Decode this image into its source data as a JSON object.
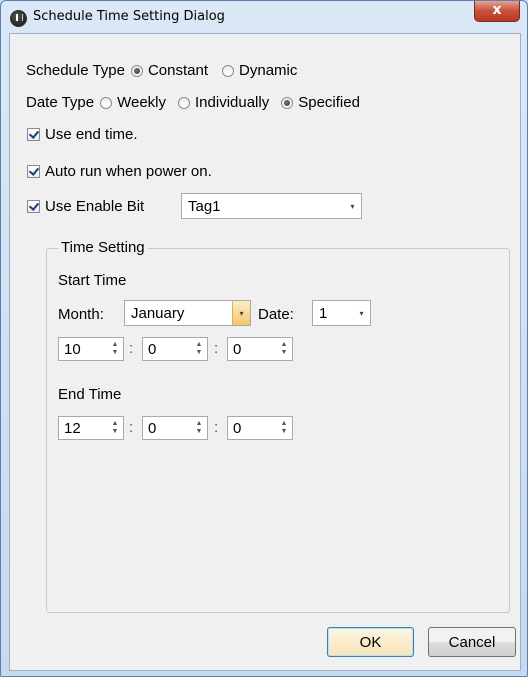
{
  "window": {
    "title": "Schedule Time Setting Dialog",
    "close_label": "x"
  },
  "schedule_type": {
    "label": "Schedule Type",
    "options": [
      {
        "label": "Constant",
        "selected": true
      },
      {
        "label": "Dynamic",
        "selected": false
      }
    ]
  },
  "date_type": {
    "label": "Date Type",
    "options": [
      {
        "label": "Weekly",
        "selected": false
      },
      {
        "label": "Individually",
        "selected": false
      },
      {
        "label": "Specified",
        "selected": true
      }
    ]
  },
  "checkboxes": {
    "use_end_time": {
      "label": "Use end time.",
      "checked": true
    },
    "auto_run": {
      "label": "Auto run when power on.",
      "checked": true
    },
    "use_enable_bit": {
      "label": "Use Enable Bit",
      "checked": true
    }
  },
  "enable_bit_tag": {
    "value": "Tag1"
  },
  "time_setting": {
    "group_label": "Time Setting",
    "start_time": {
      "label": "Start Time",
      "month_label": "Month:",
      "month_value": "January",
      "date_label": "Date:",
      "date_value": "1",
      "hour": "10",
      "minute": "0",
      "second": "0"
    },
    "end_time": {
      "label": "End Time",
      "hour": "12",
      "minute": "0",
      "second": "0"
    },
    "separator": ":"
  },
  "buttons": {
    "ok": "OK",
    "cancel": "Cancel"
  },
  "icons": {
    "arrow_down": "▾",
    "spin_up": "▲",
    "spin_down": "▼"
  }
}
